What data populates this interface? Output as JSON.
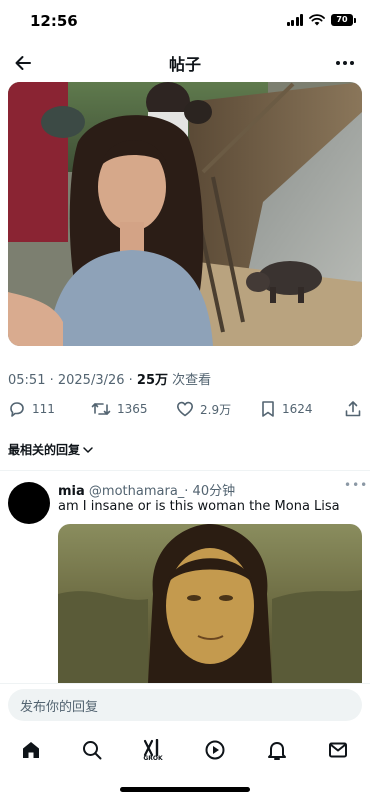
{
  "status_bar": {
    "time": "12:56",
    "battery": "70"
  },
  "header": {
    "title": "帖子"
  },
  "post": {
    "time": "05:51 · 2025/3/26 · ",
    "views_count": "25万",
    "views_label": " 次查看",
    "stats": {
      "replies": "111",
      "reposts": "1365",
      "likes": "2.9万",
      "bookmarks": "1624"
    }
  },
  "sort": {
    "label": "最相关的回复"
  },
  "reply": {
    "name": "mia",
    "handle": "@mothamara_",
    "time": "· 40分钟",
    "text": "am I insane or is this woman the Mona Lisa"
  },
  "compose": {
    "placeholder": "发布你的回复"
  },
  "bottom_nav": {
    "grok_label": "GROK"
  },
  "colors": {
    "text_primary": "#0f1419",
    "text_secondary": "#536471",
    "divider": "#eff3f4"
  }
}
